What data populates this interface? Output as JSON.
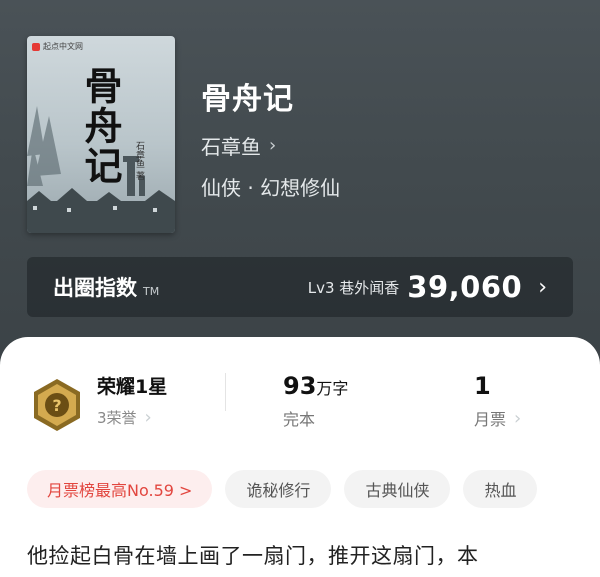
{
  "book": {
    "title": "骨舟记",
    "author": "石章鱼",
    "author_chevron": "›",
    "genre": "仙侠 · 幻想修仙",
    "cover": {
      "publisher": "起点中文网",
      "title_text": "骨舟记",
      "author_text": "石章鱼 著"
    }
  },
  "index_bar": {
    "label": "出圈指数",
    "tm": "TM",
    "level": "Lv3 巷外闻香",
    "value": "39,060",
    "chevron": "›"
  },
  "stats": {
    "honor": {
      "name": "荣耀1星",
      "sub": "3荣誉",
      "chevron": "›"
    },
    "words": {
      "value": "93",
      "unit": "万字",
      "sub": "完本"
    },
    "votes": {
      "value": "1",
      "sub": "月票",
      "chevron": "›"
    }
  },
  "tags": [
    {
      "label": "月票榜最高No.59 >"
    },
    {
      "label": "诡秘修行"
    },
    {
      "label": "古典仙侠"
    },
    {
      "label": "热血"
    }
  ],
  "synopsis": "他捡起白骨在墙上画了一扇门，推开这扇门，本",
  "colors": {
    "header_bg": "#434b4f",
    "hot_tag_bg": "#fdeeee",
    "hot_tag_text": "#e2463f",
    "medal_gold": "#c9a24a"
  }
}
